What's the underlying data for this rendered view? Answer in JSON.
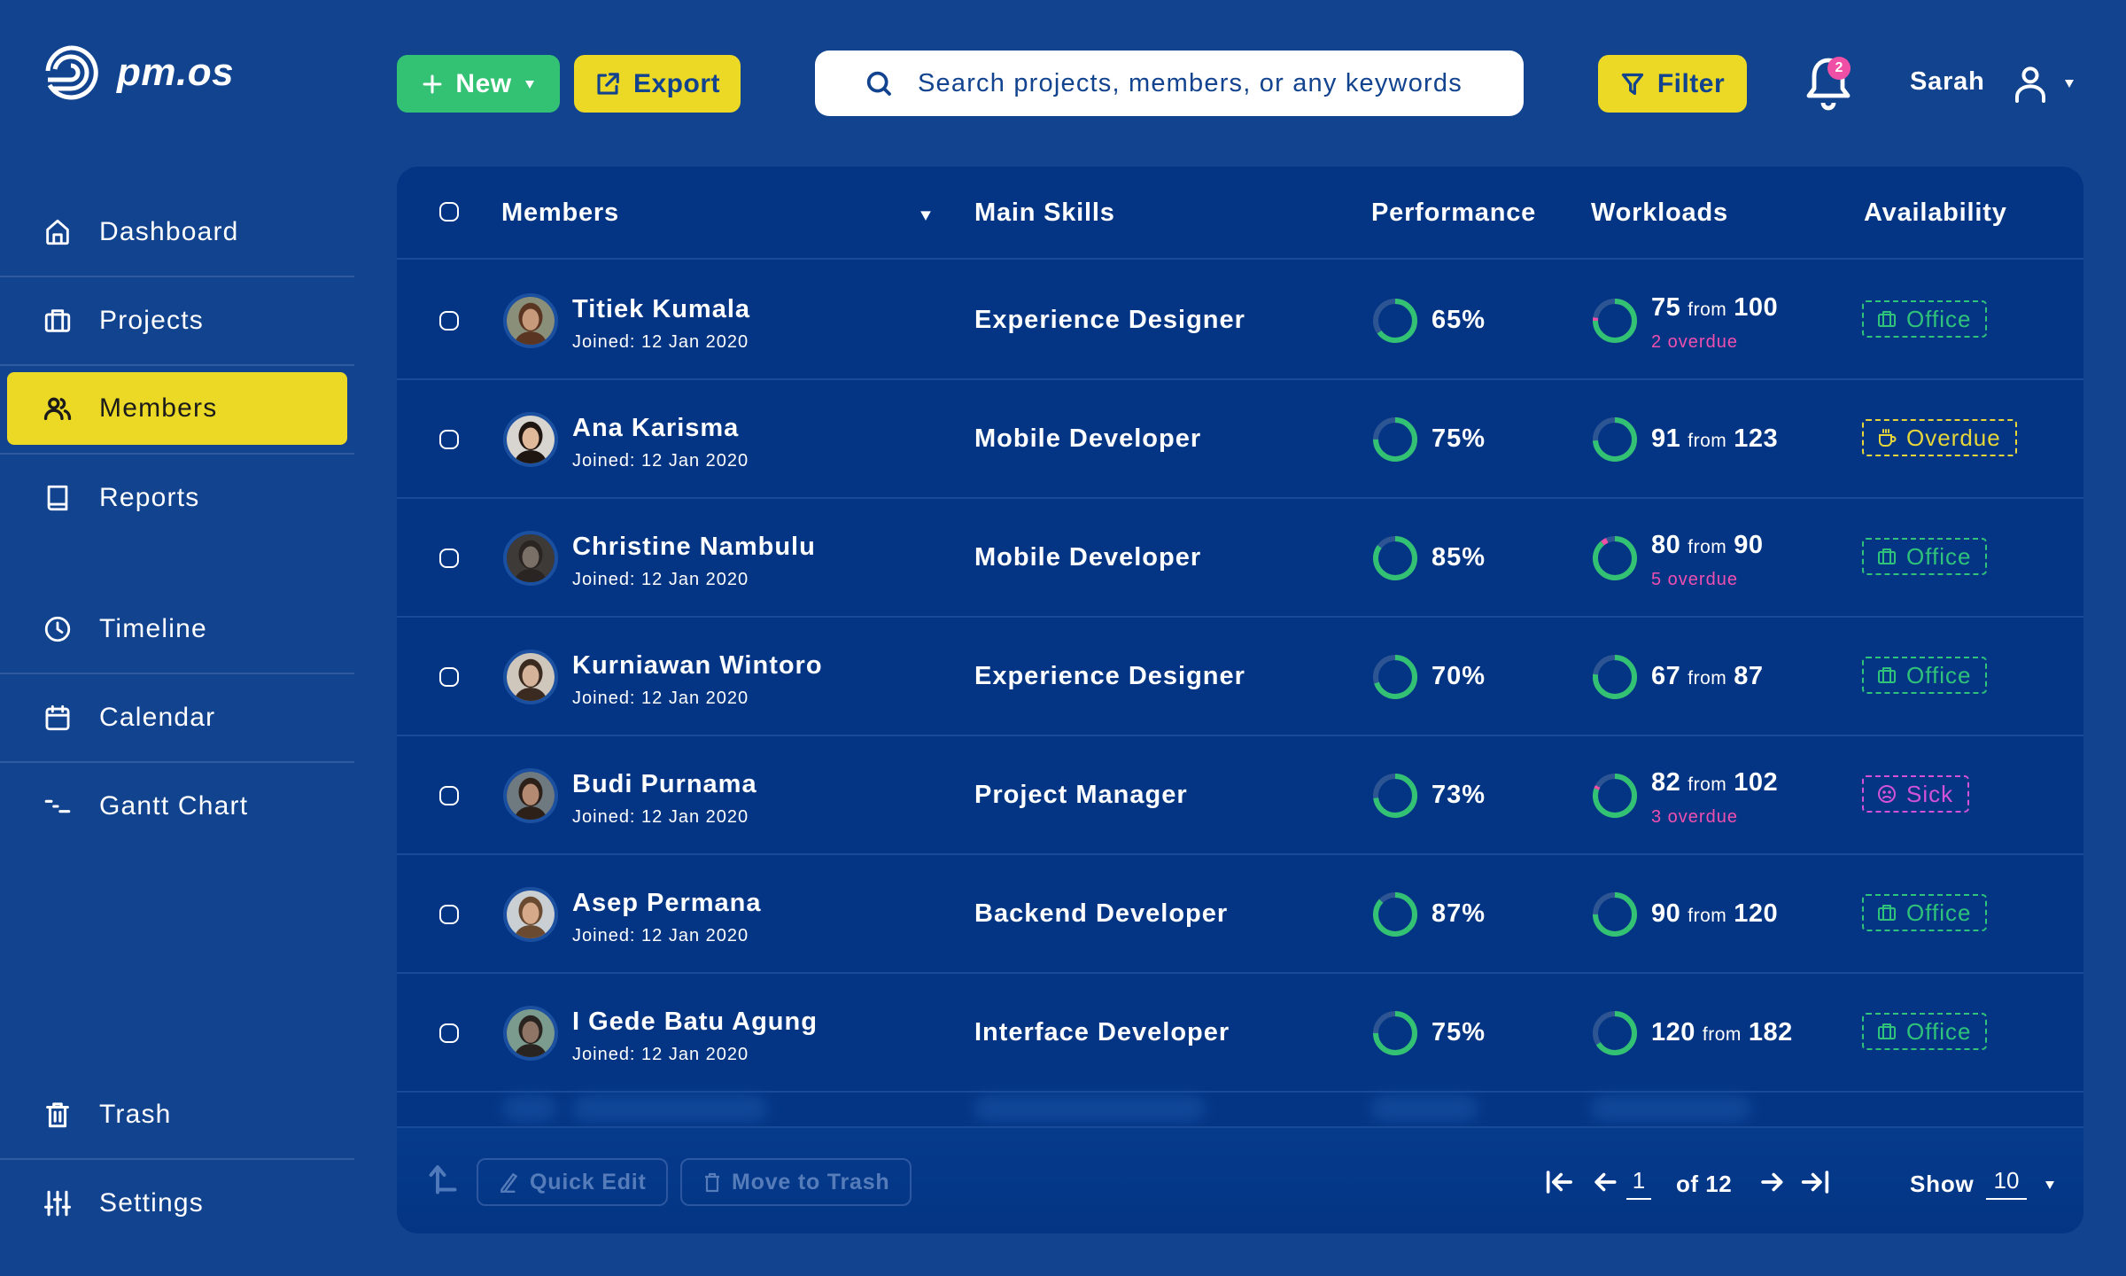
{
  "app": {
    "name": "pm.os"
  },
  "sidebar": {
    "items": [
      {
        "label": "Dashboard",
        "icon": "home-icon",
        "active": false
      },
      {
        "label": "Projects",
        "icon": "briefcase-icon",
        "active": false
      },
      {
        "label": "Members",
        "icon": "users-icon",
        "active": true
      },
      {
        "label": "Reports",
        "icon": "book-icon",
        "active": false
      },
      {
        "label": "Timeline",
        "icon": "clock-icon",
        "active": false
      },
      {
        "label": "Calendar",
        "icon": "calendar-icon",
        "active": false
      },
      {
        "label": "Gantt Chart",
        "icon": "gantt-icon",
        "active": false
      },
      {
        "label": "Trash",
        "icon": "trash-icon",
        "active": false
      },
      {
        "label": "Settings",
        "icon": "sliders-icon",
        "active": false
      }
    ]
  },
  "header": {
    "new_label": "New",
    "export_label": "Export",
    "search_placeholder": "Search projects, members, or any keywords",
    "search_value": "",
    "filter_label": "Filter",
    "notification_count": "2",
    "user_name": "Sarah"
  },
  "table": {
    "columns": {
      "members": "Members",
      "skills": "Main Skills",
      "performance": "Performance",
      "workloads": "Workloads",
      "availability": "Availability"
    },
    "from_word": "from",
    "rows": [
      {
        "name": "Titiek Kumala",
        "joined": "Joined: 12 Jan 2020",
        "skill": "Experience Designer",
        "performance": 65,
        "performance_label": "65%",
        "workload_done": 75,
        "workload_total": 100,
        "workload_done_label": "75",
        "workload_total_label": "100",
        "overdue": 2,
        "overdue_label": "2 overdue",
        "availability": "Office",
        "availability_type": "office"
      },
      {
        "name": "Ana Karisma",
        "joined": "Joined: 12 Jan 2020",
        "skill": "Mobile Developer",
        "performance": 75,
        "performance_label": "75%",
        "workload_done": 91,
        "workload_total": 123,
        "workload_done_label": "91",
        "workload_total_label": "123",
        "overdue": 0,
        "overdue_label": "",
        "availability": "Overdue",
        "availability_type": "overdue"
      },
      {
        "name": "Christine Nambulu",
        "joined": "Joined: 12 Jan 2020",
        "skill": "Mobile Developer",
        "performance": 85,
        "performance_label": "85%",
        "workload_done": 80,
        "workload_total": 90,
        "workload_done_label": "80",
        "workload_total_label": "90",
        "overdue": 5,
        "overdue_label": "5 overdue",
        "availability": "Office",
        "availability_type": "office"
      },
      {
        "name": "Kurniawan Wintoro",
        "joined": "Joined: 12 Jan 2020",
        "skill": "Experience Designer",
        "performance": 70,
        "performance_label": "70%",
        "workload_done": 67,
        "workload_total": 87,
        "workload_done_label": "67",
        "workload_total_label": "87",
        "overdue": 0,
        "overdue_label": "",
        "availability": "Office",
        "availability_type": "office"
      },
      {
        "name": "Budi Purnama",
        "joined": "Joined: 12 Jan 2020",
        "skill": "Project Manager",
        "performance": 73,
        "performance_label": "73%",
        "workload_done": 82,
        "workload_total": 102,
        "workload_done_label": "82",
        "workload_total_label": "102",
        "overdue": 3,
        "overdue_label": "3 overdue",
        "availability": "Sick",
        "availability_type": "sick"
      },
      {
        "name": "Asep Permana",
        "joined": "Joined: 12 Jan 2020",
        "skill": "Backend Developer",
        "performance": 87,
        "performance_label": "87%",
        "workload_done": 90,
        "workload_total": 120,
        "workload_done_label": "90",
        "workload_total_label": "120",
        "overdue": 0,
        "overdue_label": "",
        "availability": "Office",
        "availability_type": "office"
      },
      {
        "name": "I Gede Batu Agung",
        "joined": "Joined: 12 Jan 2020",
        "skill": "Interface Developer",
        "performance": 75,
        "performance_label": "75%",
        "workload_done": 120,
        "workload_total": 182,
        "workload_done_label": "120",
        "workload_total_label": "182",
        "overdue": 0,
        "overdue_label": "",
        "availability": "Office",
        "availability_type": "office"
      }
    ]
  },
  "footer": {
    "quick_edit_label": "Quick Edit",
    "move_to_trash_label": "Move to Trash",
    "current_page": "1",
    "page_of": "of 12",
    "show_label": "Show",
    "page_size": "10"
  },
  "colors": {
    "background": "#12438f",
    "card": "#033584",
    "accent_yellow": "#ecd925",
    "accent_green": "#33c173",
    "accent_pink": "#f04fa6",
    "ring_track": "#2d5593",
    "office": "#2fc27a",
    "overdue": "#e6d63a",
    "sick": "#d452d8"
  }
}
